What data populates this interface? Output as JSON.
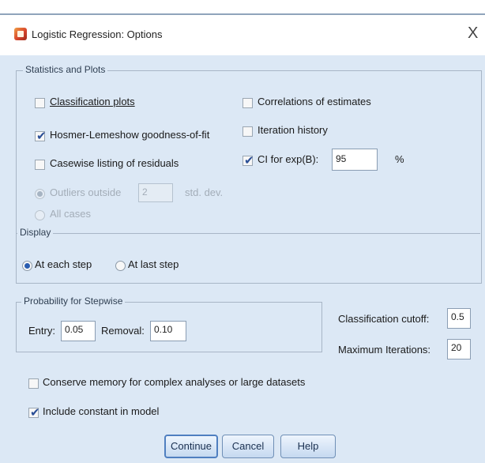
{
  "window": {
    "title": "Logistic Regression: Options",
    "close": "X"
  },
  "statistics": {
    "legend": "Statistics and Plots",
    "classification_plots": {
      "label": "Classification plots",
      "checked": false
    },
    "hosmer": {
      "label": "Hosmer-Lemeshow goodness-of-fit",
      "checked": true
    },
    "casewise": {
      "label": "Casewise listing of residuals",
      "checked": false
    },
    "outliers": {
      "label": "Outliers outside",
      "value": "2",
      "unit": "std. dev.",
      "selected": true,
      "enabled": false
    },
    "all_cases": {
      "label": "All cases",
      "selected": false,
      "enabled": false
    },
    "correlations": {
      "label": "Correlations of estimates",
      "checked": false
    },
    "iteration_history": {
      "label": "Iteration history",
      "checked": false
    },
    "ci": {
      "label": "CI for exp(B):",
      "checked": true,
      "value": "95",
      "unit": "%"
    }
  },
  "display": {
    "legend": "Display",
    "each_step": {
      "label": "At each step",
      "selected": true
    },
    "last_step": {
      "label": "At last step",
      "selected": false
    }
  },
  "stepwise": {
    "legend": "Probability for Stepwise",
    "entry_label": "Entry:",
    "entry_value": "0.05",
    "removal_label": "Removal:",
    "removal_value": "0.10"
  },
  "classification_cutoff": {
    "label": "Classification cutoff:",
    "value": "0.5"
  },
  "max_iterations": {
    "label": "Maximum Iterations:",
    "value": "20"
  },
  "conserve_memory": {
    "label": "Conserve memory for complex analyses or large datasets",
    "checked": false
  },
  "include_constant": {
    "label": "Include constant in model",
    "checked": true
  },
  "buttons": {
    "continue": "Continue",
    "cancel": "Cancel",
    "help": "Help"
  },
  "colors": {
    "dialog_bg": "#dce8f5",
    "check": "#2a4e96",
    "radio": "#2a5db0"
  }
}
